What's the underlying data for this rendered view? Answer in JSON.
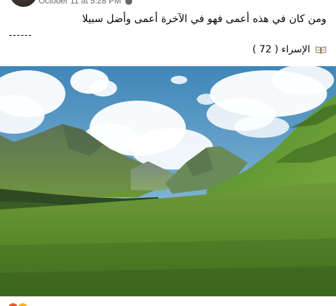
{
  "post": {
    "timestamp": "October 11 at 5:28 PM",
    "text_line": "ومن كان في هذه أعمى فهو في الآخرة أعمى وأضل سبيلا",
    "separator": "------",
    "source": "الإسراء ( 72 )"
  },
  "icons": {
    "audience": "globe-icon",
    "source": "open-book-icon",
    "reactions": [
      "haha-icon",
      "wow-icon"
    ]
  },
  "image": {
    "subject": "green-valley-mountains-photo"
  }
}
